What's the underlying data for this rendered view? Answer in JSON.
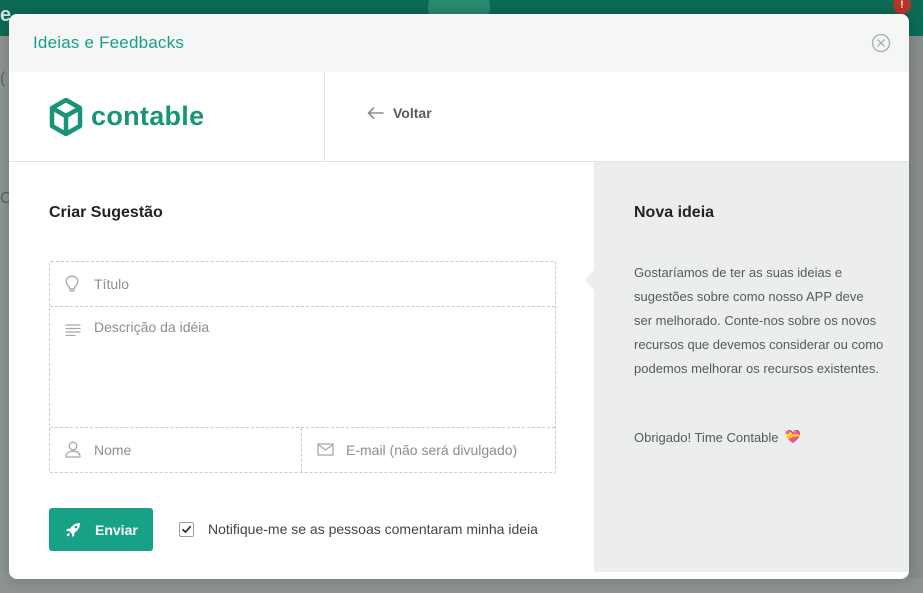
{
  "modal": {
    "title": "Ideias e Feedbacks",
    "brand_name": "contable",
    "back_label": "Voltar"
  },
  "form": {
    "title": "Criar Sugestão",
    "fields": {
      "title_placeholder": "Título",
      "description_placeholder": "Descrição da idéia",
      "name_placeholder": "Nome",
      "email_placeholder": "E-mail (não será divulgado)"
    },
    "submit_label": "Enviar",
    "notify_label": "Notifique-me se as pessoas comentaram minha ideia",
    "notify_checked": true
  },
  "side": {
    "title": "Nova ideia",
    "text": "Gostaríamos de ter as suas ideias e sugestões sobre como nosso APP deve ser melhorado. Conte-nos sobre os novos recursos que devemos considerar ou como podemos melhorar os recursos existentes.",
    "thanks": "Obrigado! Time Contable",
    "thanks_emoji": "💝"
  },
  "background": {
    "notification_count": "!"
  },
  "icons": {
    "close": "close-circle-icon",
    "brand": "contable-cube-logo-icon",
    "back": "arrow-left-icon",
    "title": "lightbulb-icon",
    "description": "lines-icon",
    "name": "user-icon",
    "email": "envelope-icon",
    "submit": "rocket-icon",
    "checkbox": "checkmark-icon"
  },
  "colors": {
    "accent": "#17a287",
    "brand": "#1a9479",
    "panel_bg": "#eceeee",
    "topbar": "#0d6b55"
  }
}
